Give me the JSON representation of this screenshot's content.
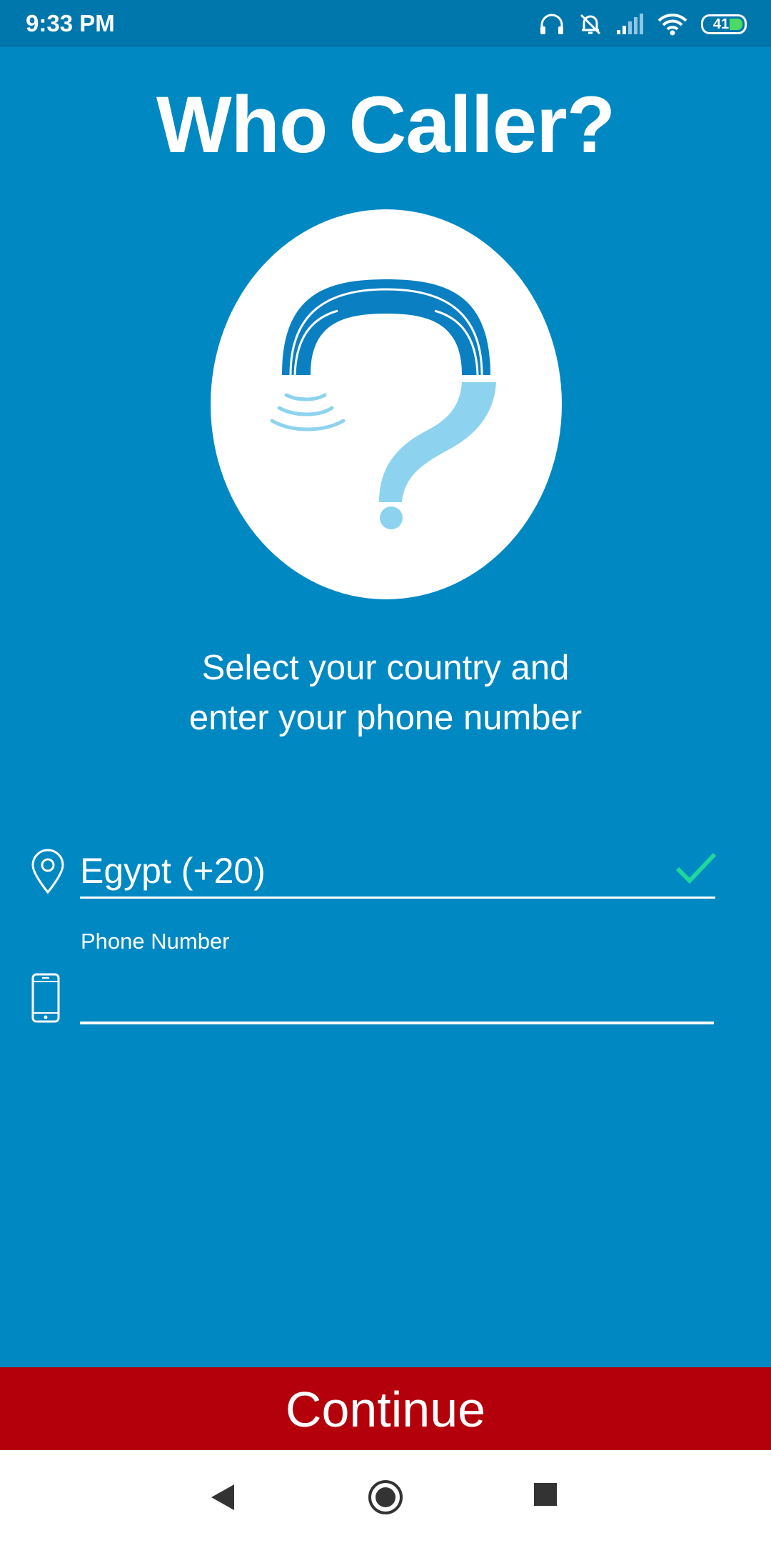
{
  "status_bar": {
    "time": "9:33 PM",
    "battery_level": "41",
    "icons": [
      "headphones-icon",
      "bell-muted-icon",
      "signal-icon",
      "wifi-icon",
      "battery-icon"
    ]
  },
  "app": {
    "title": "Who Caller?",
    "subtitle_line1": "Select your country and",
    "subtitle_line2": "enter your phone number"
  },
  "form": {
    "country_value": "Egypt (+20)",
    "phone_label": "Phone Number",
    "phone_value": ""
  },
  "actions": {
    "continue_label": "Continue"
  },
  "colors": {
    "background": "#0088c2",
    "status_bar": "#0077ac",
    "continue_button": "#b3000b",
    "check": "#1ed79a",
    "logo_dark": "#0a7fc1",
    "logo_light": "#8dd3ef"
  }
}
